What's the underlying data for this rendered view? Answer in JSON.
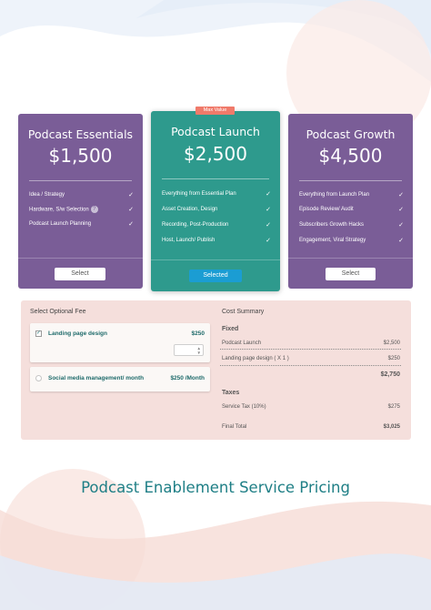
{
  "colors": {
    "purple": "#7a5d97",
    "teal": "#2e9a8d",
    "selected_blue": "#1b9dd3",
    "badge": "#f07a6a",
    "panel_bg": "#f5dfdc",
    "title_teal": "#1f7f86"
  },
  "plans": [
    {
      "name": "Podcast Essentials",
      "price": "$1,500",
      "features": [
        "Idea / Strategy",
        "Hardware, S/w Selection",
        "Podcast Launch Planning"
      ],
      "button": "Select"
    },
    {
      "badge": "Max Value",
      "name": "Podcast Launch",
      "price": "$2,500",
      "features": [
        "Everything from Essential Plan",
        "Asset Creation, Design",
        "Recording, Post-Production",
        "Host, Launch/ Publish"
      ],
      "button": "Selected"
    },
    {
      "name": "Podcast Growth",
      "price": "$4,500",
      "features": [
        "Everything from Launch Plan",
        "Episode Review/ Audit",
        "Subscribers Growth Hacks",
        "Engagement, Viral Strategy"
      ],
      "button": "Select"
    }
  ],
  "optional_fee": {
    "title": "Select Optional Fee",
    "items": [
      {
        "name": "Landing page design",
        "price": "$250",
        "checked": true
      },
      {
        "name": "Social media management/ month",
        "price": "$250 /Month",
        "checked": false
      }
    ]
  },
  "cost_summary": {
    "title": "Cost Summary",
    "fixed_label": "Fixed",
    "lines": [
      {
        "label": "Podcast Launch",
        "value": "$2,500"
      },
      {
        "label": "Landing page design ( X 1 )",
        "value": "$250"
      }
    ],
    "subtotal": "$2,750",
    "taxes_label": "Taxes",
    "tax_line": {
      "label": "Service Tax (10%)",
      "value": "$275"
    },
    "final": {
      "label": "Final Total",
      "value": "$3,025"
    }
  },
  "page_title": "Podcast Enablement Service Pricing"
}
